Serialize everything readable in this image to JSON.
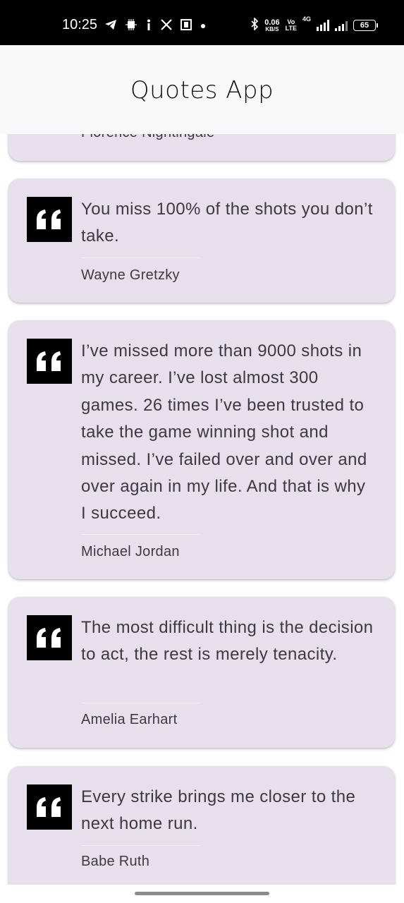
{
  "status_bar": {
    "time": "10:25",
    "left_icons": [
      "telegram-icon",
      "chip-icon",
      "accessibility-icon",
      "x-icon",
      "notification-app-icon",
      "dot-icon"
    ],
    "right_icons": [
      "bluetooth-icon",
      "data-speed",
      "volte-icon",
      "signal-4g-icon",
      "signal-icon",
      "battery-icon"
    ],
    "data_speed_value": "0.06",
    "data_speed_unit": "KB/S",
    "volte_top": "Vo",
    "volte_bottom": "LTE",
    "network_type": "4G",
    "battery_level": "65"
  },
  "app_bar": {
    "title": "Quotes App"
  },
  "quotes": [
    {
      "author": "Florence Nightingale"
    },
    {
      "text": "You miss 100% of the shots you don’t take.",
      "author": "Wayne Gretzky"
    },
    {
      "text": "I’ve missed more than 9000 shots in my career. I’ve lost almost 300 games. 26 times I’ve been trusted to take the game winning shot and missed. I’ve failed over and over and over again in my life. And that is why I succeed.",
      "author": "Michael Jordan"
    },
    {
      "text": "The most difficult thing is the decision to act, the rest is merely tenacity.",
      "author": "Amelia Earhart"
    },
    {
      "text": "Every strike brings me closer to the next home run.",
      "author": "Babe Ruth"
    }
  ],
  "colors": {
    "card_background": "#e7dfec",
    "quote_icon_background": "#000000",
    "text": "#3c3a40",
    "app_bar_background": "#f8f8f9"
  }
}
